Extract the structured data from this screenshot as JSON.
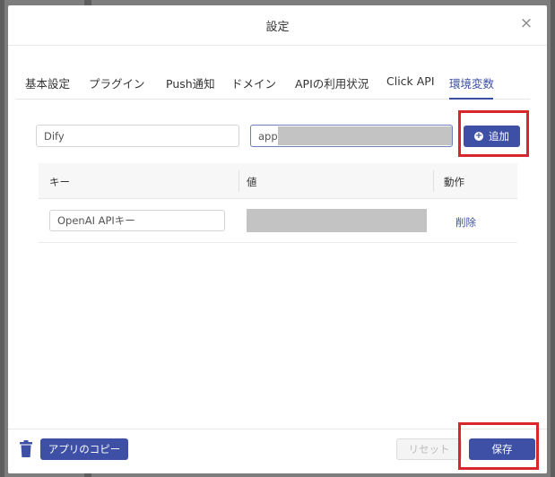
{
  "dialog": {
    "title": "設定",
    "close_glyph": "×"
  },
  "tabs": [
    {
      "label": "基本設定",
      "active": false
    },
    {
      "label": "プラグイン",
      "active": false
    },
    {
      "label": "Push通知",
      "active": false
    },
    {
      "label": "ドメイン",
      "active": false
    },
    {
      "label": "APIの利用状況",
      "active": false
    },
    {
      "label": "Click API",
      "active": false
    },
    {
      "label": "環境変数",
      "active": true
    }
  ],
  "env_form": {
    "key_value": "Dify",
    "value_prefix": "app-",
    "add_label": "追加",
    "add_icon": "plus-circle-icon"
  },
  "table": {
    "headers": {
      "key": "キー",
      "value": "値",
      "action": "動作"
    },
    "rows": [
      {
        "key": "OpenAI APIキー",
        "action": "削除"
      }
    ]
  },
  "footer": {
    "delete_icon": "trash-icon",
    "copy_app_label": "アプリのコピー",
    "reset_label": "リセット",
    "save_label": "保存"
  },
  "colors": {
    "accent": "#3e50a6",
    "highlight_box": "#d9262c",
    "masked": "#c3c3c3"
  }
}
